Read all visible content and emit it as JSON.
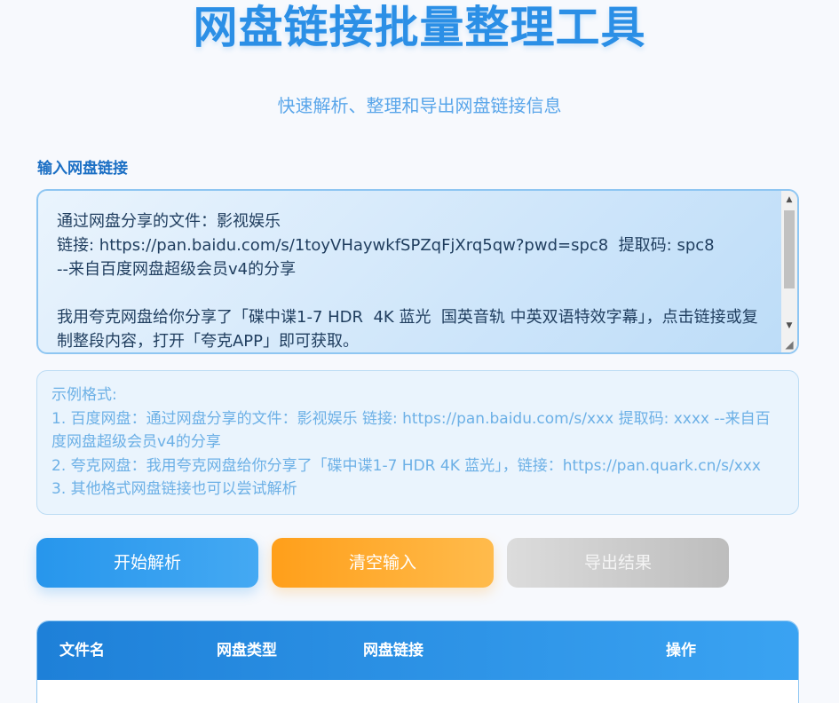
{
  "header": {
    "title": "网盘链接批量整理工具",
    "subtitle": "快速解析、整理和导出网盘链接信息"
  },
  "input": {
    "label": "输入网盘链接",
    "value": "通过网盘分享的文件：影视娱乐\n链接: https://pan.baidu.com/s/1toyVHaywkfSPZqFjXrq5qw?pwd=spc8  提取码: spc8\n--来自百度网盘超级会员v4的分享\n\n我用夸克网盘给你分享了「碟中谍1-7 HDR  4K 蓝光  国英音轨 中英双语特效字幕」，点击链接或复制整段内容，打开「夸克APP」即可获取。"
  },
  "example": {
    "title": "示例格式:",
    "lines": [
      "1. 百度网盘：通过网盘分享的文件：影视娱乐 链接: https://pan.baidu.com/s/xxx 提取码: xxxx --来自百度网盘超级会员v4的分享",
      "2. 夸克网盘：我用夸克网盘给你分享了「碟中谍1-7 HDR 4K 蓝光」，链接：https://pan.quark.cn/s/xxx",
      "3. 其他格式网盘链接也可以尝试解析"
    ]
  },
  "buttons": {
    "parse": "开始解析",
    "clear": "清空输入",
    "export": "导出结果"
  },
  "table": {
    "columns": [
      "文件名",
      "网盘类型",
      "网盘链接",
      "操作"
    ]
  },
  "colors": {
    "accent": "#2b8fe6",
    "parse_button": "#2796ec",
    "clear_button": "#ff9f1a",
    "export_button_disabled": "#cfcfcf"
  }
}
